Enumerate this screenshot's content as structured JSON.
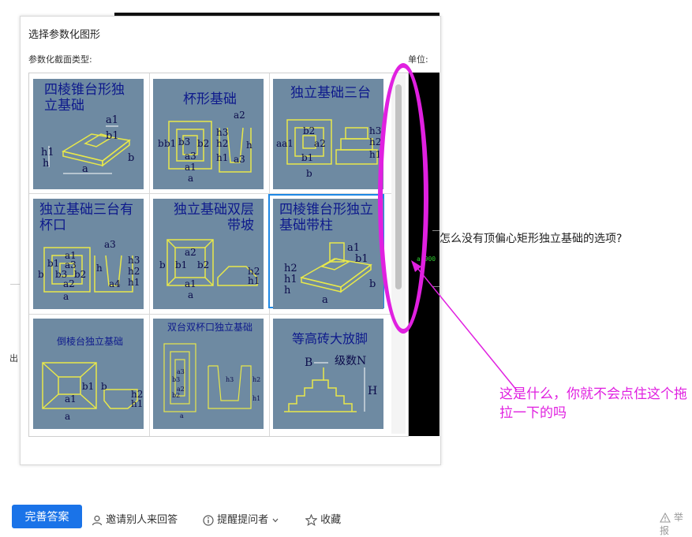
{
  "dialog": {
    "title": "选择参数化图形",
    "section_type_label": "参数化截面类型:",
    "unit_label": "单位:",
    "preview_value": "a 900",
    "shapes": [
      {
        "title": "四棱锥台形独立基础",
        "dims": [
          "a1",
          "b1",
          "h1",
          "h",
          "a",
          "b"
        ]
      },
      {
        "title": "杯形基础",
        "dims": [
          "a2",
          "b",
          "b1",
          "b3",
          "b2",
          "a3",
          "h3",
          "h2",
          "h1",
          "a",
          "a1",
          "h"
        ]
      },
      {
        "title": "独立基础三台",
        "dims": [
          "aa1",
          "b2",
          "a2",
          "b1",
          "b",
          "h3",
          "h2",
          "h1"
        ]
      },
      {
        "title": "独立基础三台有杯口",
        "dims": [
          "a3",
          "a1",
          "b1",
          "a3",
          "b3",
          "b2",
          "b",
          "a2",
          "a",
          "h3",
          "h2",
          "h1",
          "h",
          "a4"
        ]
      },
      {
        "title": "独立基础双层带坡",
        "dims": [
          "a2",
          "b1",
          "b2",
          "b",
          "a1",
          "a",
          "h2",
          "h1"
        ]
      },
      {
        "title": "四棱锥台形独立基础带柱",
        "dims": [
          "a1",
          "b1",
          "h2",
          "h1",
          "h",
          "a",
          "b"
        ]
      },
      {
        "title": "倒棱台独立基础",
        "dims": [
          "b1",
          "b",
          "a1",
          "a",
          "h2",
          "h1"
        ]
      },
      {
        "title": "双台双杯口独立基础",
        "dims": [
          "a3",
          "b3",
          "a2",
          "b2",
          "h3",
          "h2",
          "h1",
          "a"
        ]
      },
      {
        "title": "等高砖大放脚",
        "dims": [
          "B",
          "级数N",
          "H"
        ]
      }
    ]
  },
  "annotation": {
    "question": "怎么没有顶偏心矩形独立基础的选项?",
    "comment": "这是什么，你就不会点住这个拖拉一下的吗",
    "ring_color": "#e020e0"
  },
  "footer": {
    "answer_button": "完善答案",
    "invite": "邀请别人来回答",
    "remind": "提醒提问者",
    "favorite": "收藏",
    "report": "举报"
  },
  "colors": {
    "card_bg": "#6e8aa2",
    "title_blue": "#0e1a8c",
    "selection": "#1e88e5",
    "line_yellow": "#e8e84a"
  },
  "selected_index": 5
}
